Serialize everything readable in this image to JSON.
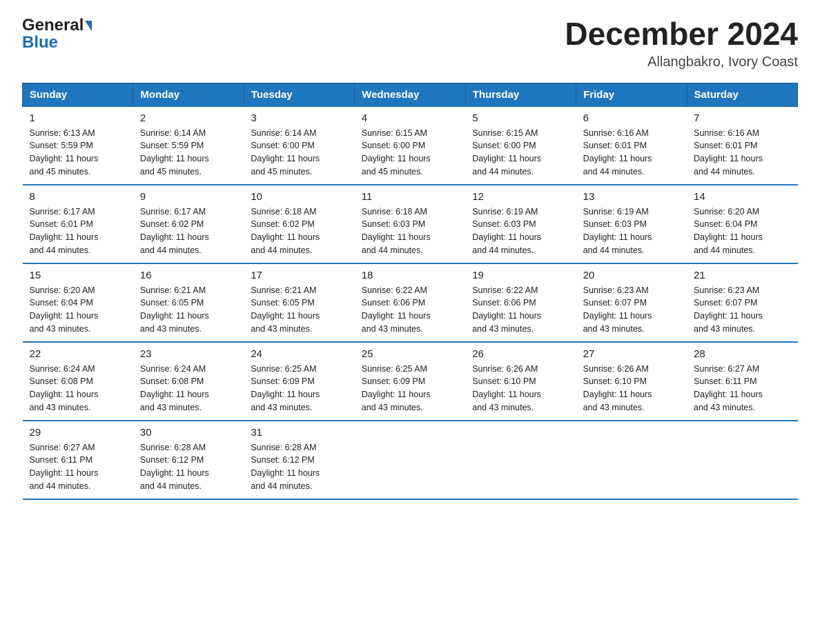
{
  "logo": {
    "text1": "General",
    "text2": "Blue"
  },
  "title": {
    "month_year": "December 2024",
    "location": "Allangbakro, Ivory Coast"
  },
  "days_of_week": [
    "Sunday",
    "Monday",
    "Tuesday",
    "Wednesday",
    "Thursday",
    "Friday",
    "Saturday"
  ],
  "weeks": [
    [
      {
        "day": "1",
        "sunrise": "6:13 AM",
        "sunset": "5:59 PM",
        "daylight": "11 hours and 45 minutes."
      },
      {
        "day": "2",
        "sunrise": "6:14 AM",
        "sunset": "5:59 PM",
        "daylight": "11 hours and 45 minutes."
      },
      {
        "day": "3",
        "sunrise": "6:14 AM",
        "sunset": "6:00 PM",
        "daylight": "11 hours and 45 minutes."
      },
      {
        "day": "4",
        "sunrise": "6:15 AM",
        "sunset": "6:00 PM",
        "daylight": "11 hours and 45 minutes."
      },
      {
        "day": "5",
        "sunrise": "6:15 AM",
        "sunset": "6:00 PM",
        "daylight": "11 hours and 44 minutes."
      },
      {
        "day": "6",
        "sunrise": "6:16 AM",
        "sunset": "6:01 PM",
        "daylight": "11 hours and 44 minutes."
      },
      {
        "day": "7",
        "sunrise": "6:16 AM",
        "sunset": "6:01 PM",
        "daylight": "11 hours and 44 minutes."
      }
    ],
    [
      {
        "day": "8",
        "sunrise": "6:17 AM",
        "sunset": "6:01 PM",
        "daylight": "11 hours and 44 minutes."
      },
      {
        "day": "9",
        "sunrise": "6:17 AM",
        "sunset": "6:02 PM",
        "daylight": "11 hours and 44 minutes."
      },
      {
        "day": "10",
        "sunrise": "6:18 AM",
        "sunset": "6:02 PM",
        "daylight": "11 hours and 44 minutes."
      },
      {
        "day": "11",
        "sunrise": "6:18 AM",
        "sunset": "6:03 PM",
        "daylight": "11 hours and 44 minutes."
      },
      {
        "day": "12",
        "sunrise": "6:19 AM",
        "sunset": "6:03 PM",
        "daylight": "11 hours and 44 minutes."
      },
      {
        "day": "13",
        "sunrise": "6:19 AM",
        "sunset": "6:03 PM",
        "daylight": "11 hours and 44 minutes."
      },
      {
        "day": "14",
        "sunrise": "6:20 AM",
        "sunset": "6:04 PM",
        "daylight": "11 hours and 44 minutes."
      }
    ],
    [
      {
        "day": "15",
        "sunrise": "6:20 AM",
        "sunset": "6:04 PM",
        "daylight": "11 hours and 43 minutes."
      },
      {
        "day": "16",
        "sunrise": "6:21 AM",
        "sunset": "6:05 PM",
        "daylight": "11 hours and 43 minutes."
      },
      {
        "day": "17",
        "sunrise": "6:21 AM",
        "sunset": "6:05 PM",
        "daylight": "11 hours and 43 minutes."
      },
      {
        "day": "18",
        "sunrise": "6:22 AM",
        "sunset": "6:06 PM",
        "daylight": "11 hours and 43 minutes."
      },
      {
        "day": "19",
        "sunrise": "6:22 AM",
        "sunset": "6:06 PM",
        "daylight": "11 hours and 43 minutes."
      },
      {
        "day": "20",
        "sunrise": "6:23 AM",
        "sunset": "6:07 PM",
        "daylight": "11 hours and 43 minutes."
      },
      {
        "day": "21",
        "sunrise": "6:23 AM",
        "sunset": "6:07 PM",
        "daylight": "11 hours and 43 minutes."
      }
    ],
    [
      {
        "day": "22",
        "sunrise": "6:24 AM",
        "sunset": "6:08 PM",
        "daylight": "11 hours and 43 minutes."
      },
      {
        "day": "23",
        "sunrise": "6:24 AM",
        "sunset": "6:08 PM",
        "daylight": "11 hours and 43 minutes."
      },
      {
        "day": "24",
        "sunrise": "6:25 AM",
        "sunset": "6:09 PM",
        "daylight": "11 hours and 43 minutes."
      },
      {
        "day": "25",
        "sunrise": "6:25 AM",
        "sunset": "6:09 PM",
        "daylight": "11 hours and 43 minutes."
      },
      {
        "day": "26",
        "sunrise": "6:26 AM",
        "sunset": "6:10 PM",
        "daylight": "11 hours and 43 minutes."
      },
      {
        "day": "27",
        "sunrise": "6:26 AM",
        "sunset": "6:10 PM",
        "daylight": "11 hours and 43 minutes."
      },
      {
        "day": "28",
        "sunrise": "6:27 AM",
        "sunset": "6:11 PM",
        "daylight": "11 hours and 43 minutes."
      }
    ],
    [
      {
        "day": "29",
        "sunrise": "6:27 AM",
        "sunset": "6:11 PM",
        "daylight": "11 hours and 44 minutes."
      },
      {
        "day": "30",
        "sunrise": "6:28 AM",
        "sunset": "6:12 PM",
        "daylight": "11 hours and 44 minutes."
      },
      {
        "day": "31",
        "sunrise": "6:28 AM",
        "sunset": "6:12 PM",
        "daylight": "11 hours and 44 minutes."
      },
      null,
      null,
      null,
      null
    ]
  ],
  "labels": {
    "sunrise": "Sunrise:",
    "sunset": "Sunset:",
    "daylight": "Daylight:"
  }
}
